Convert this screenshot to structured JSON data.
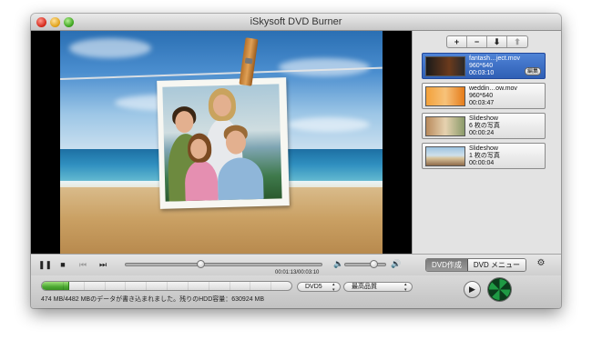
{
  "window": {
    "title": "iSkysoft DVD Burner"
  },
  "toolbar": {
    "add_label": "+",
    "remove_label": "−",
    "down_label": "⬇",
    "up_label": "⬆"
  },
  "items": [
    {
      "name": "fantash…ject.mov",
      "resolution": "960*640",
      "duration": "00:03:10",
      "edit_label": "編集",
      "thumb": "video-thumb-dark"
    },
    {
      "name": "weddin…ow.mov",
      "resolution": "960*640",
      "duration": "00:03:47",
      "thumb": "video-thumb-orange"
    },
    {
      "name": "Slideshow",
      "resolution": "6 枚の写真",
      "duration": "00:00:24",
      "thumb": "photo-thumb-family"
    },
    {
      "name": "Slideshow",
      "resolution": "1 枚の写真",
      "duration": "00:00:04",
      "thumb": "photo-thumb-beach"
    }
  ],
  "player": {
    "time": "00:01:13/00:03:10",
    "position_fraction": 0.38,
    "volume_fraction": 0.7
  },
  "tabs": {
    "dvd_create": "DVD作成",
    "dvd_menu": "DVD メニュー"
  },
  "bottom": {
    "status": "474 MB/4482 MBのデータが書き込まれました。残りのHDD容量：630924 MB",
    "progress_fraction": 0.11,
    "disc_type": "DVD5",
    "quality": "最高品質"
  },
  "colors": {
    "selected": "#2f5fb5",
    "progress": "#4ca832"
  }
}
